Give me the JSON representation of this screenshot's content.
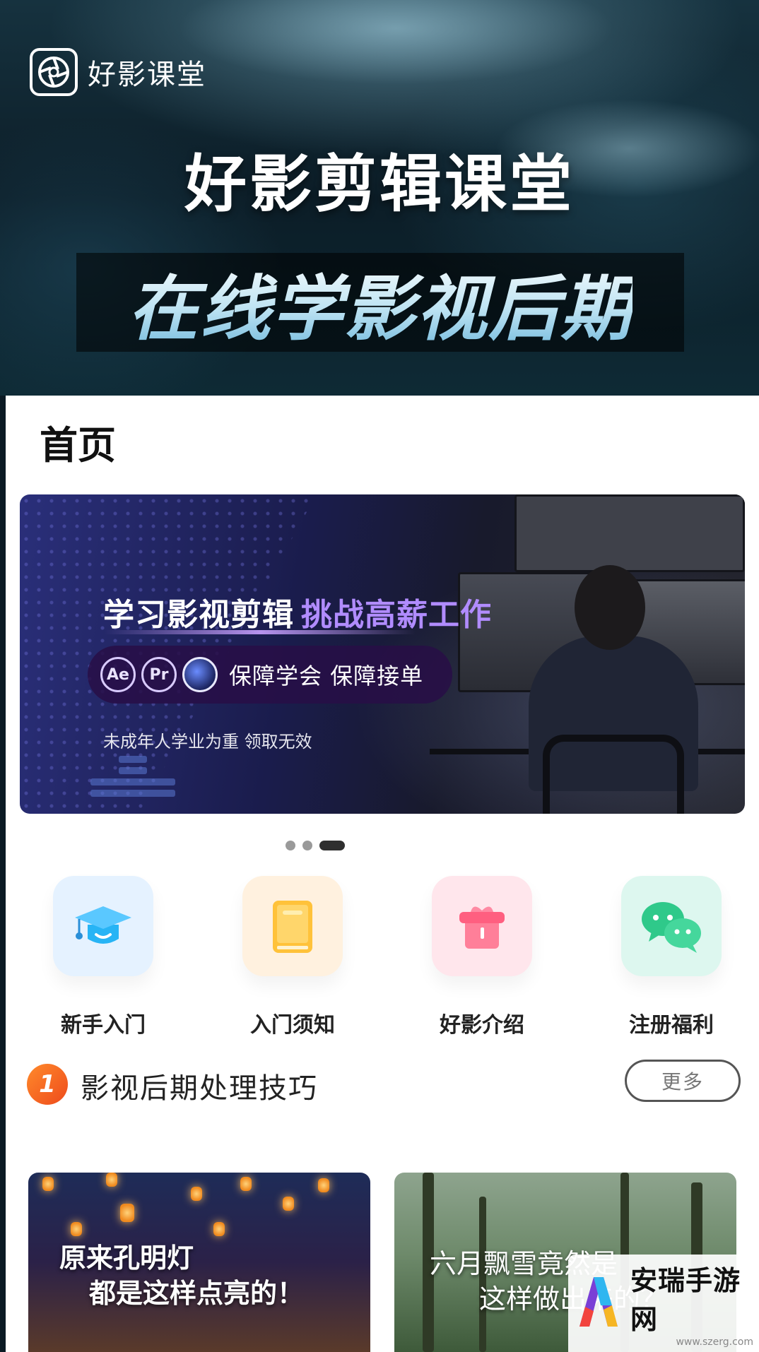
{
  "hero": {
    "brand_name": "好影课堂",
    "title": "好影剪辑课堂",
    "subtitle": "在线学影视后期"
  },
  "page": {
    "title": "首页"
  },
  "banner": {
    "headline_main": "学习影视剪辑",
    "headline_accent": "挑战高薪工作",
    "app_badges": [
      "Ae",
      "Pr"
    ],
    "pill_text": "保障学会 保障接单",
    "note": "未成年人学业为重 领取无效",
    "slide_count": 3,
    "active_slide": 3
  },
  "quick_entries": [
    {
      "label": "新手入门",
      "icon": "graduation-cap-icon"
    },
    {
      "label": "入门须知",
      "icon": "book-icon"
    },
    {
      "label": "好影介绍",
      "icon": "gift-icon"
    },
    {
      "label": "注册福利",
      "icon": "chat-bubbles-icon"
    }
  ],
  "section": {
    "badge": "1",
    "title": "影视后期处理技巧",
    "more_label": "更多"
  },
  "cards": [
    {
      "line1": "原来孔明灯",
      "line2": "都是这样点亮的！"
    },
    {
      "line1": "六月飘雪竟然是",
      "line2": "这样做出来的？"
    }
  ],
  "watermark": {
    "name": "安瑞手游网",
    "url": "www.szerg.com"
  },
  "colors": {
    "accent_orange": "#ee4b1c",
    "banner_accent": "#b18cff"
  }
}
